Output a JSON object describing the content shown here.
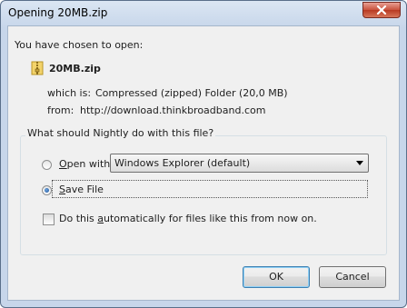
{
  "window": {
    "title": "Opening 20MB.zip"
  },
  "intro": "You have chosen to open:",
  "file": {
    "name": "20MB.zip",
    "which_is_label": "which is:",
    "which_is_value": "Compressed (zipped) Folder (20,0 MB)",
    "from_label": "from:",
    "from_value": "http://download.thinkbroadband.com"
  },
  "group": {
    "legend": "What should Nightly do with this file?",
    "open_with": {
      "label": "Open with",
      "selected": false
    },
    "open_with_app": "Windows Explorer (default)",
    "save_file": {
      "label": "Save File",
      "selected": true
    },
    "auto": {
      "label_pre": "Do this ",
      "label_ul": "a",
      "label_post": "utomatically for files like this from now on.",
      "checked": false
    }
  },
  "buttons": {
    "ok": "OK",
    "cancel": "Cancel"
  }
}
